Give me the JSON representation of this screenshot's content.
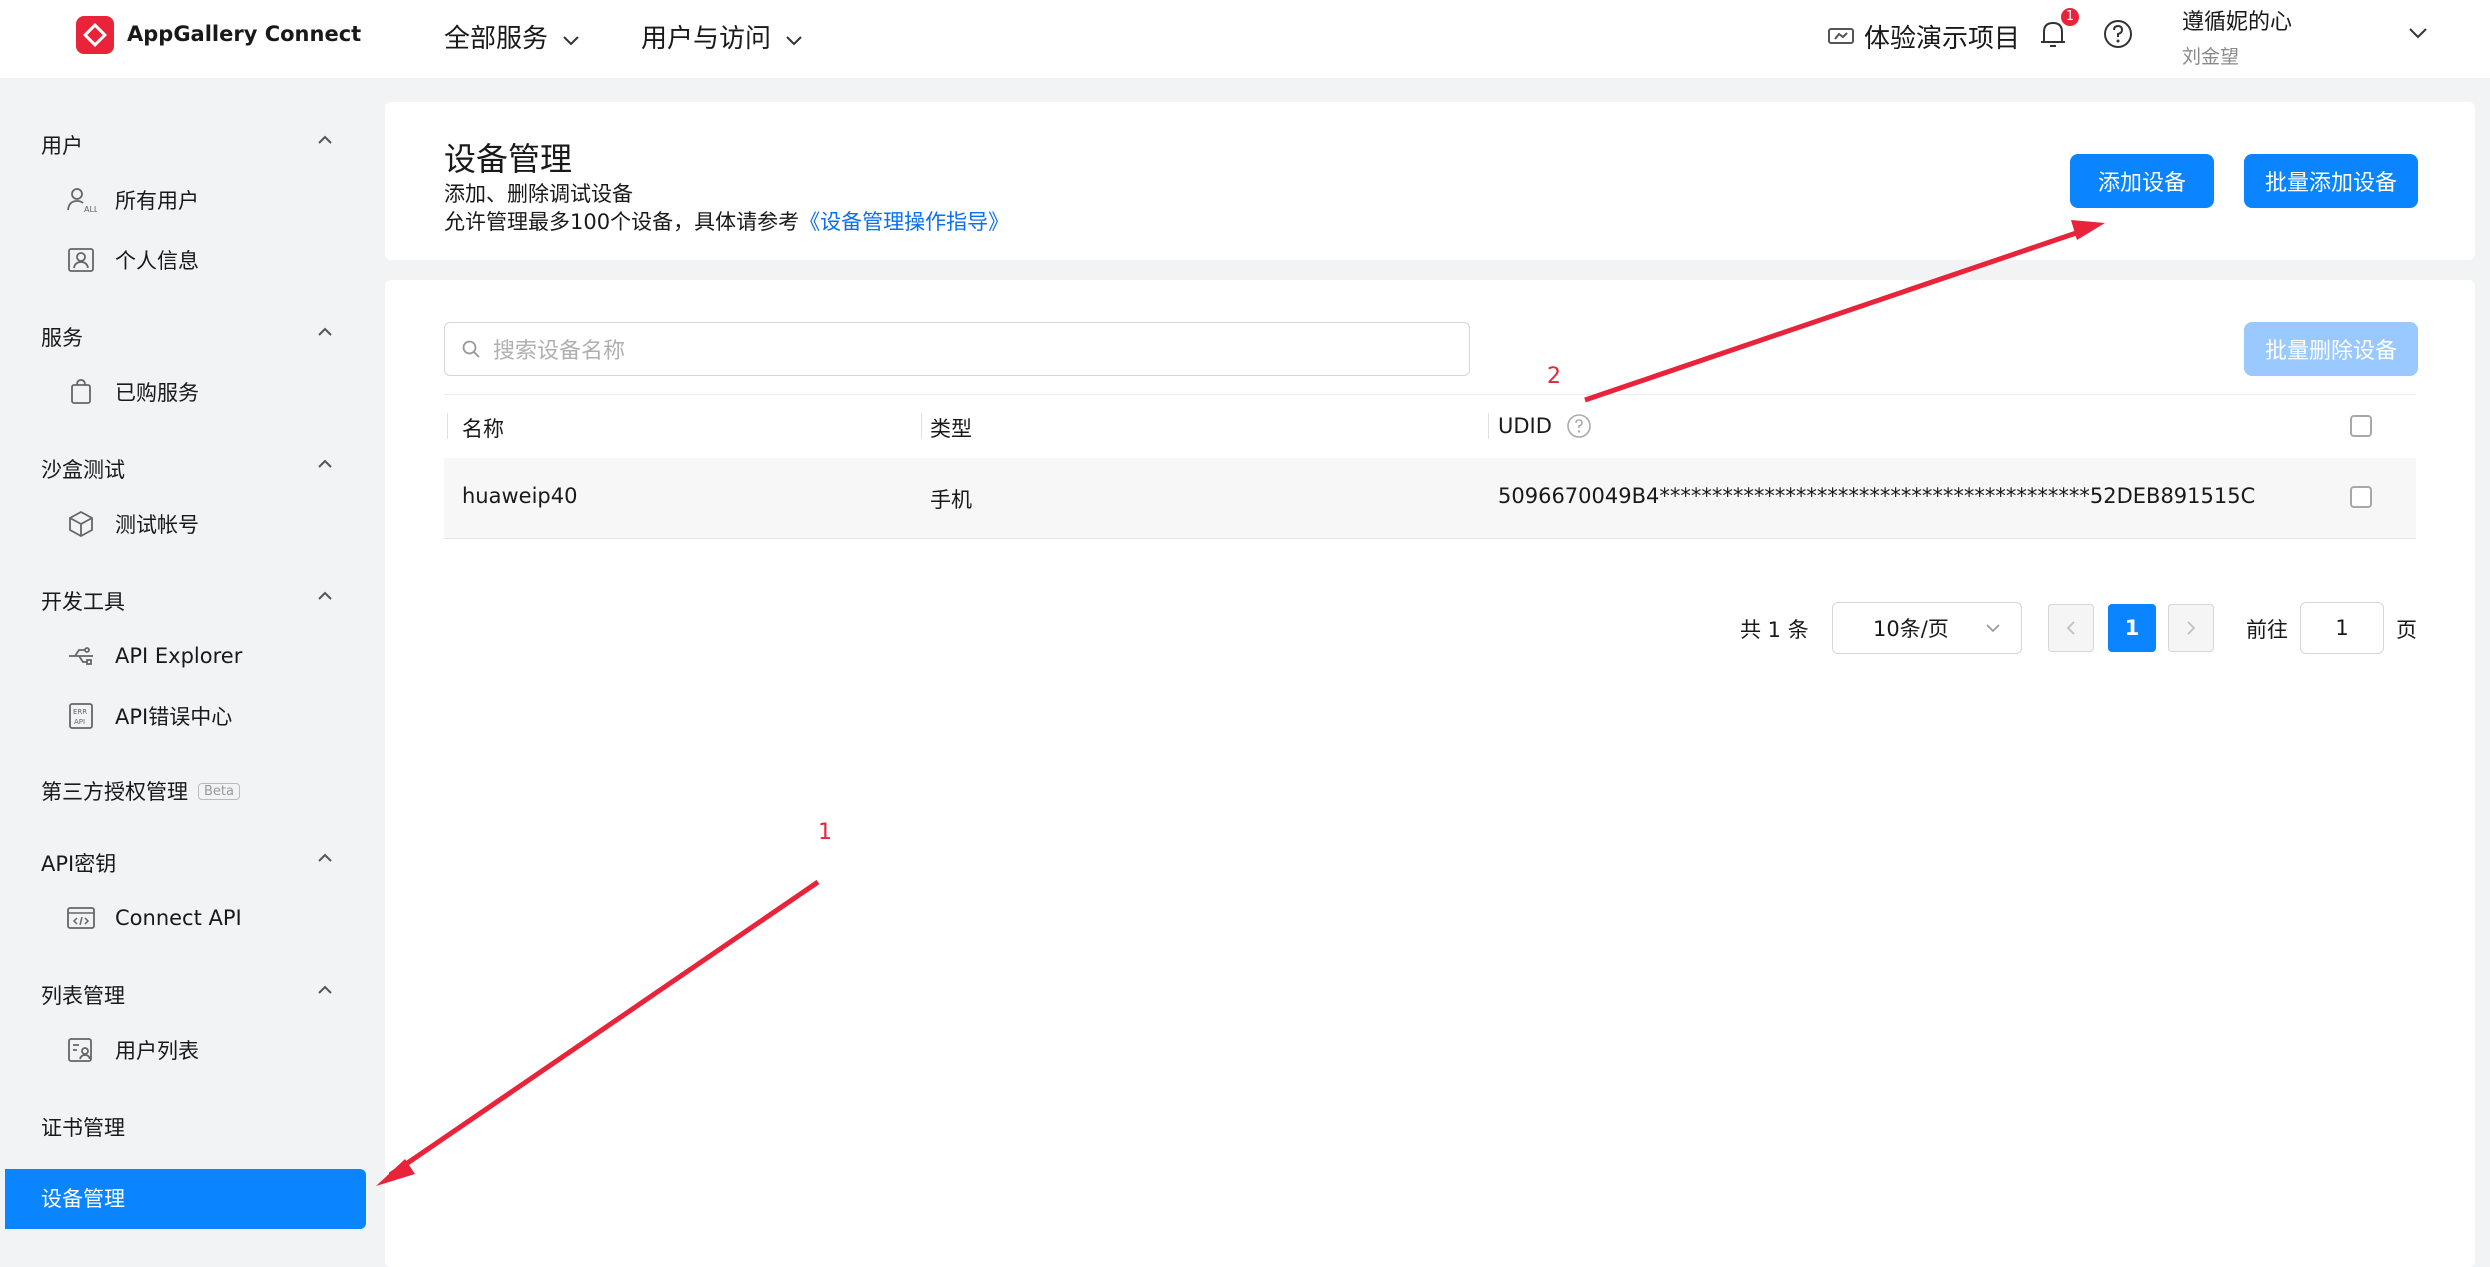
{
  "header": {
    "logo_text": "AppGallery Connect",
    "nav": [
      "全部服务",
      "用户与访问"
    ],
    "demo_label": "体验演示项目",
    "notification_count": "1",
    "user_name": "遵循妮的心",
    "user_sub": "刘金望"
  },
  "sidebar": {
    "sections": {
      "users": "用户",
      "services": "服务",
      "sandbox": "沙盒测试",
      "devtools": "开发工具",
      "thirdparty": "第三方授权管理",
      "thirdparty_badge": "Beta",
      "apikey": "API密钥",
      "lists": "列表管理",
      "certs": "证书管理",
      "devices": "设备管理"
    },
    "items": {
      "all_users": "所有用户",
      "profile": "个人信息",
      "purchased": "已购服务",
      "test_account": "测试帐号",
      "api_explorer": "API Explorer",
      "api_errors": "API错误中心",
      "connect_api": "Connect API",
      "user_list": "用户列表"
    }
  },
  "page": {
    "title": "设备管理",
    "desc1": "添加、删除调试设备",
    "desc2_prefix": "允许管理最多100个设备，具体请参考",
    "desc2_link": "《设备管理操作指导》",
    "add_button": "添加设备",
    "batch_add_button": "批量添加设备",
    "batch_delete_button": "批量删除设备"
  },
  "search": {
    "placeholder": "搜索设备名称"
  },
  "table": {
    "columns": [
      "名称",
      "类型",
      "UDID"
    ],
    "rows": [
      {
        "name": "huaweip40",
        "type": "手机",
        "udid": "5096670049B4*****************************************52DEB891515C"
      }
    ]
  },
  "pagination": {
    "total": "共 1 条",
    "page_size": "10条/页",
    "current_page": "1",
    "goto_label": "前往",
    "goto_value": "1",
    "page_suffix": "页"
  },
  "annotations": {
    "a1": "1",
    "a2": "2"
  },
  "colors": {
    "primary": "#0a84ff",
    "brand_red": "#e8233a",
    "arrow": "#e8233a"
  }
}
